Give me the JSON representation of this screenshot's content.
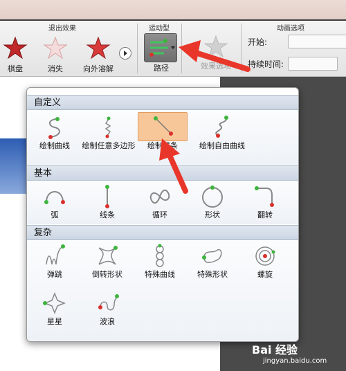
{
  "ribbon": {
    "exit_effects_label": "退出效果",
    "motion_type_label": "运动型",
    "animation_options_label": "动画选项",
    "effects": [
      {
        "label": "棋盘"
      },
      {
        "label": "消失"
      },
      {
        "label": "向外溶解"
      }
    ],
    "path_label": "路径",
    "effect_options_label": "效果选项",
    "start_label": "开始:",
    "duration_label": "持续时间:"
  },
  "popup": {
    "sections": [
      {
        "title": "自定义",
        "items": [
          {
            "label": "绘制曲线",
            "icon": "draw-curve-icon"
          },
          {
            "label": "绘制任意多边形",
            "icon": "draw-freeform-icon"
          },
          {
            "label": "绘制线条",
            "icon": "draw-line-icon",
            "selected": true
          },
          {
            "label": "绘制自由曲线",
            "icon": "draw-scribble-icon"
          }
        ]
      },
      {
        "title": "基本",
        "items": [
          {
            "label": "弧",
            "icon": "arc-icon"
          },
          {
            "label": "线条",
            "icon": "line-icon"
          },
          {
            "label": "循环",
            "icon": "loop-icon"
          },
          {
            "label": "形状",
            "icon": "shape-icon"
          },
          {
            "label": "翻转",
            "icon": "turn-icon"
          }
        ]
      },
      {
        "title": "复杂",
        "items": [
          {
            "label": "弹跳",
            "icon": "bounce-icon"
          },
          {
            "label": "倒转形状",
            "icon": "inverted-shape-icon"
          },
          {
            "label": "特殊曲线",
            "icon": "special-curve-icon"
          },
          {
            "label": "特殊形状",
            "icon": "special-shape-icon"
          },
          {
            "label": "螺旋",
            "icon": "spiral-icon"
          },
          {
            "label": "星星",
            "icon": "star-icon"
          },
          {
            "label": "波浪",
            "icon": "wave-icon"
          }
        ]
      }
    ]
  },
  "watermark": {
    "brand": "Bai 经验",
    "url": "jingyan.baidu.com"
  },
  "colors": {
    "annotation_arrow": "#e8372a",
    "selected_item": "#f7c79a",
    "start_dot": "#3db53d",
    "end_dot": "#d9302b"
  }
}
